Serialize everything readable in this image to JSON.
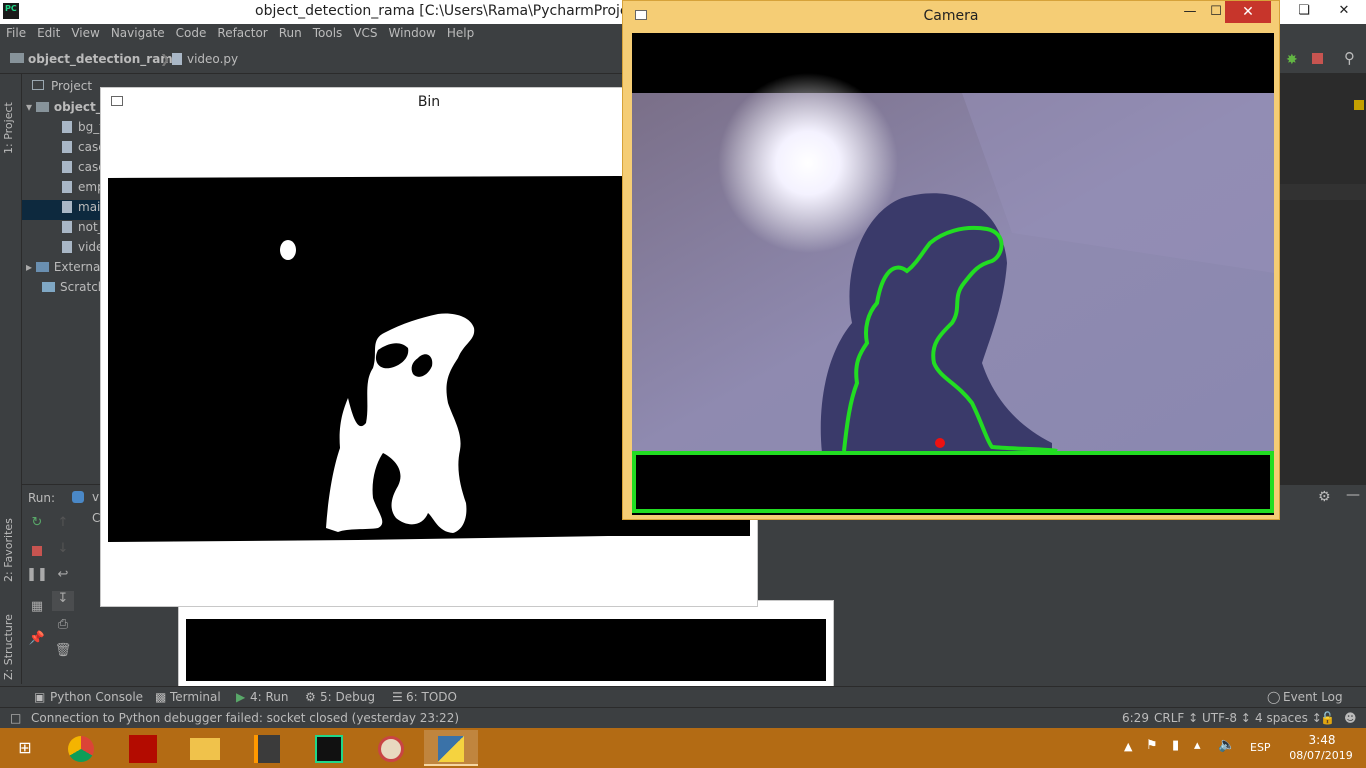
{
  "pycharm": {
    "window_title": "object_detection_rama [C:\\Users\\Rama\\PycharmProjects",
    "logo": "PC",
    "menu": [
      "File",
      "Edit",
      "View",
      "Navigate",
      "Code",
      "Refactor",
      "Run",
      "Tools",
      "VCS",
      "Window",
      "Help"
    ],
    "breadcrumb": {
      "project": "object_detection_rama",
      "file": "video.py"
    },
    "project_panel": {
      "header": "Project",
      "tab_partial": "video.py",
      "root": "object_",
      "files": [
        "bg_f",
        "case",
        "case",
        "emp",
        "mai",
        "not_",
        "vide"
      ],
      "external": "Externa",
      "scratches": "Scratch"
    },
    "left_tabs": [
      "1: Project",
      "2: Favorites",
      "Z: Structure"
    ],
    "run_panel": {
      "label": "Run:",
      "tab_partial": "vi",
      "console_partial": "C"
    },
    "tool_windows": [
      {
        "label": "Python Console",
        "icon": "python-console-icon"
      },
      {
        "label": "Terminal",
        "icon": "terminal-icon"
      },
      {
        "label": "4: Run",
        "icon": "run-icon"
      },
      {
        "label": "5: Debug",
        "icon": "debug-icon"
      },
      {
        "label": "6: TODO",
        "icon": "todo-icon"
      }
    ],
    "event_log": "Event Log",
    "status": {
      "message": "Connection to Python debugger failed: socket closed (yesterday 23:22)",
      "position": "6:29",
      "line_sep": "CRLF ↕",
      "encoding": "UTF-8 ↕",
      "indent": "4 spaces ↕"
    }
  },
  "bin_window": {
    "title": "Bin"
  },
  "camera_window": {
    "title": "Camera",
    "contour_color": "#22dd22",
    "marker_color": "#ee1111"
  },
  "taskbar": {
    "apps": [
      "windows-start",
      "chrome",
      "acrobat",
      "file-explorer",
      "sublime-text",
      "pycharm",
      "paint",
      "python"
    ],
    "tray": {
      "lang": "ESP",
      "time": "3:48",
      "date": "08/07/2019"
    }
  }
}
